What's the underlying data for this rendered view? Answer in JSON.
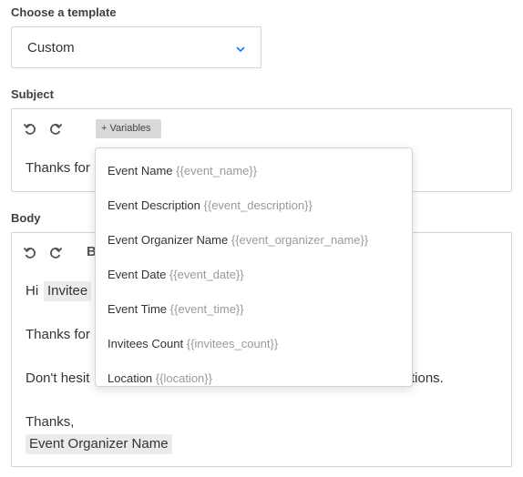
{
  "template": {
    "label": "Choose a template",
    "selected": "Custom",
    "icon": "chevron-down-icon",
    "accent": "#1a73e8"
  },
  "subject": {
    "label": "Subject",
    "undo_icon": "undo-icon",
    "redo_icon": "redo-icon",
    "variables_label": "+ Variables",
    "text": "Thanks for"
  },
  "body": {
    "label": "Body",
    "undo_icon": "undo-icon",
    "redo_icon": "redo-icon",
    "toolbar_partial": "B",
    "greeting": "Hi",
    "invitee_variable": "Invitee",
    "line2": "Thanks for",
    "line3_start": "Don't hesit",
    "line3_end": "tions.",
    "signoff": "Thanks,",
    "organizer_variable": "Event Organizer Name"
  },
  "variables_menu": {
    "items": [
      {
        "name": "Event Name",
        "code": "{{event_name}}"
      },
      {
        "name": "Event Description",
        "code": "{{event_description}}"
      },
      {
        "name": "Event Organizer Name",
        "code": "{{event_organizer_name}}"
      },
      {
        "name": "Event Date",
        "code": "{{event_date}}"
      },
      {
        "name": "Event Time",
        "code": "{{event_time}}"
      },
      {
        "name": "Invitees Count",
        "code": "{{invitees_count}}"
      },
      {
        "name": "Location",
        "code": "{{location}}"
      }
    ]
  }
}
